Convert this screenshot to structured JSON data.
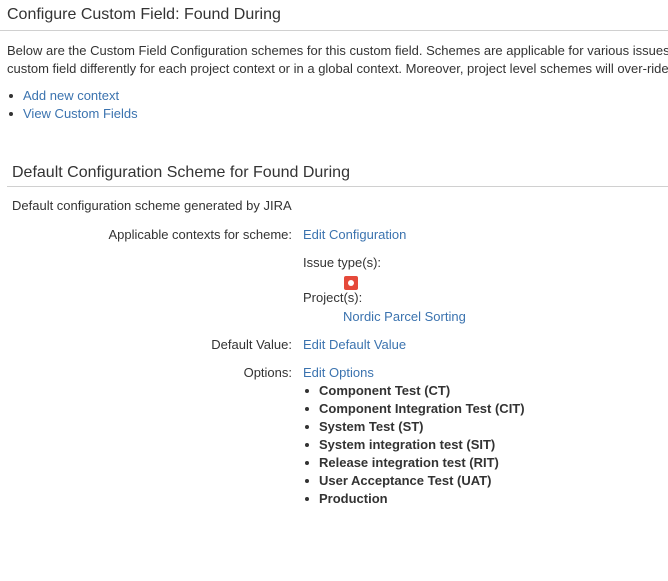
{
  "page": {
    "title": "Configure Custom Field: Found During",
    "intro_line1": "Below are the Custom Field Configuration schemes for this custom field. Schemes are applicable for various issues",
    "intro_line2": "custom field differently for each project context or in a global context. Moreover, project level schemes will over-ride"
  },
  "actions": {
    "add_context": "Add new context",
    "view_custom_fields": "View Custom Fields"
  },
  "scheme": {
    "title": "Default Configuration Scheme for Found During",
    "description": "Default configuration scheme generated by JIRA",
    "contexts_label": "Applicable contexts for scheme:",
    "edit_configuration": "Edit Configuration",
    "issue_types_label": "Issue type(s):",
    "issue_type_icon": "bug-icon",
    "projects_label": "Project(s):",
    "project_name": "Nordic Parcel Sorting",
    "default_value_label": "Default Value:",
    "edit_default_value": "Edit Default Value",
    "options_label": "Options:",
    "edit_options": "Edit Options",
    "options": [
      "Component Test (CT)",
      "Component Integration Test (CIT)",
      "System Test (ST)",
      "System integration test (SIT)",
      "Release integration test (RIT)",
      "User Acceptance Test (UAT)",
      "Production"
    ]
  },
  "colors": {
    "link": "#3b73af",
    "text": "#333333",
    "bug": "#e5493a"
  }
}
